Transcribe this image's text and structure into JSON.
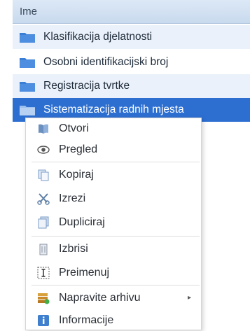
{
  "list": {
    "header": "Ime",
    "rows": [
      {
        "label": "Klasifikacija djelatnosti"
      },
      {
        "label": "Osobni identifikacijski broj"
      },
      {
        "label": "Registracija tvrtke"
      },
      {
        "label": "Sistematizacija radnih mjesta"
      }
    ]
  },
  "context_menu": {
    "items": [
      {
        "label": "Otvori",
        "icon": "open-book-icon"
      },
      {
        "label": "Pregled",
        "icon": "eye-icon"
      },
      {
        "label": "Kopiraj",
        "icon": "copy-icon"
      },
      {
        "label": "Izrezi",
        "icon": "scissors-icon"
      },
      {
        "label": "Dupliciraj",
        "icon": "duplicate-icon"
      },
      {
        "label": "Izbrisi",
        "icon": "trash-icon"
      },
      {
        "label": "Preimenuj",
        "icon": "rename-icon"
      },
      {
        "label": "Napravite arhivu",
        "icon": "archive-icon",
        "submenu_arrow": "▸"
      },
      {
        "label": "Informacije",
        "icon": "info-icon"
      }
    ]
  },
  "colors": {
    "selection": "#2d6fd1",
    "alt_row": "#eaf1fa",
    "folder": "#3a7fd5"
  }
}
